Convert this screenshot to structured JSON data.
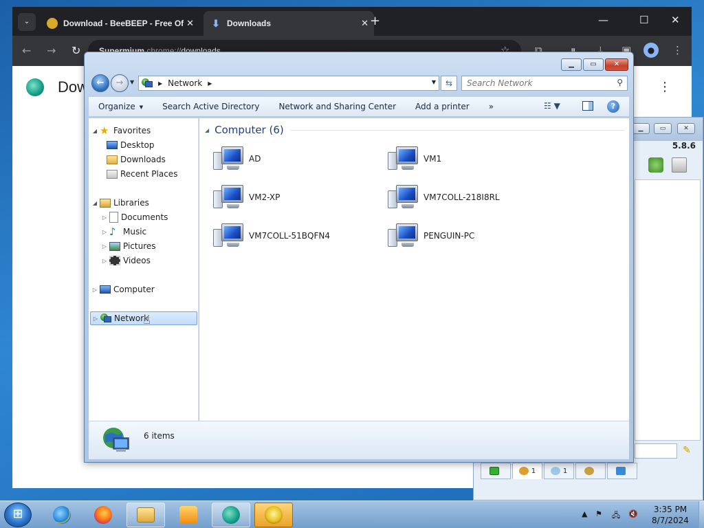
{
  "browser": {
    "tabs": [
      {
        "title": "Download - BeeBEEP - Free Of"
      },
      {
        "title": "Downloads"
      }
    ],
    "url_scheme": "chrome://",
    "url_path": "downloads",
    "url_brand": "Supermium",
    "page_title": "Dow"
  },
  "beebeep": {
    "version": "5.8.6",
    "tabs": [
      {
        "count": "1"
      },
      {
        "count": "1"
      }
    ]
  },
  "explorer": {
    "breadcrumb": [
      "Network"
    ],
    "search_placeholder": "Search Network",
    "commands": {
      "organize": "Organize",
      "search_ad": "Search Active Directory",
      "network_sharing": "Network and Sharing Center",
      "add_printer": "Add a printer",
      "more": "»"
    },
    "nav": {
      "favorites": "Favorites",
      "desktop": "Desktop",
      "downloads": "Downloads",
      "recent_places": "Recent Places",
      "libraries": "Libraries",
      "documents": "Documents",
      "music": "Music",
      "pictures": "Pictures",
      "videos": "Videos",
      "computer": "Computer",
      "network": "Network"
    },
    "group_title": "Computer (6)",
    "computers": [
      "AD",
      "VM1",
      "VM2-XP",
      "VM7COLL-218I8RL",
      "VM7COLL-51BQFN4",
      "PENGUIN-PC"
    ],
    "status": "6 items"
  },
  "taskbar": {
    "time": "3:35 PM",
    "date": "8/7/2024"
  },
  "colors": {
    "accent": "#1e3f86",
    "selection": "#c1dcfc",
    "taskbar_active": "#e8a326"
  }
}
